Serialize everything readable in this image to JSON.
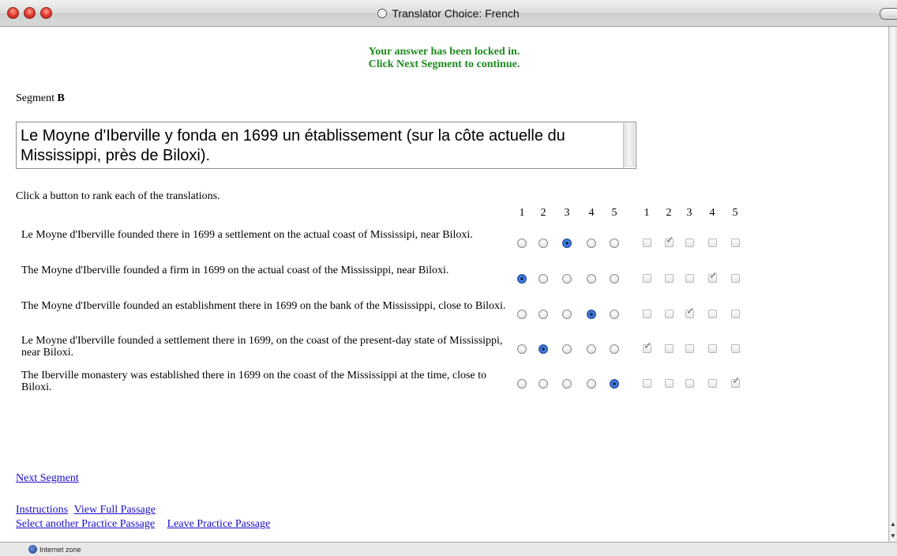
{
  "window": {
    "title": "Translator Choice: French"
  },
  "notice": {
    "line1": "Your answer has been locked in.",
    "line2": "Click Next Segment to continue."
  },
  "segment": {
    "label": "Segment",
    "letter": "B"
  },
  "source_text": "Le Moyne d'Iberville y fonda en 1699 un établissement (sur la côte actuelle du Mississippi, près de Biloxi).",
  "instructions": "Click a button to rank each of the translations.",
  "column_numbers": [
    "1",
    "2",
    "3",
    "4",
    "5",
    "1",
    "2",
    "3",
    "4",
    "5"
  ],
  "translations": [
    {
      "text": "Le Moyne d'Iberville founded there in 1699 a settlement on the actual coast of Mississipi, near Biloxi.",
      "selected_rank": 3,
      "checked": 2
    },
    {
      "text": "The Moyne d'Iberville founded a firm in 1699 on the actual coast of the Mississippi, near Biloxi.",
      "selected_rank": 1,
      "checked": 4
    },
    {
      "text": "The Moyne d'Iberville founded an establishment there in 1699 on the bank of the Mississippi, close to Biloxi.",
      "selected_rank": 4,
      "checked": 3
    },
    {
      "text": "Le Moyne d'Iberville founded a settlement there in 1699, on the coast of the present-day state of Mississippi, near Biloxi.",
      "selected_rank": 2,
      "checked": 1
    },
    {
      "text": "The Iberville monastery was established there in 1699 on the coast of the Mississippi at the time, close to Biloxi.",
      "selected_rank": 5,
      "checked": 5
    }
  ],
  "links": {
    "next_segment": "Next Segment",
    "instructions": "Instructions",
    "view_full_passage": "View Full Passage",
    "select_another": "Select another Practice Passage",
    "leave_practice": "Leave Practice Passage"
  },
  "status": {
    "zone": "Internet zone"
  }
}
